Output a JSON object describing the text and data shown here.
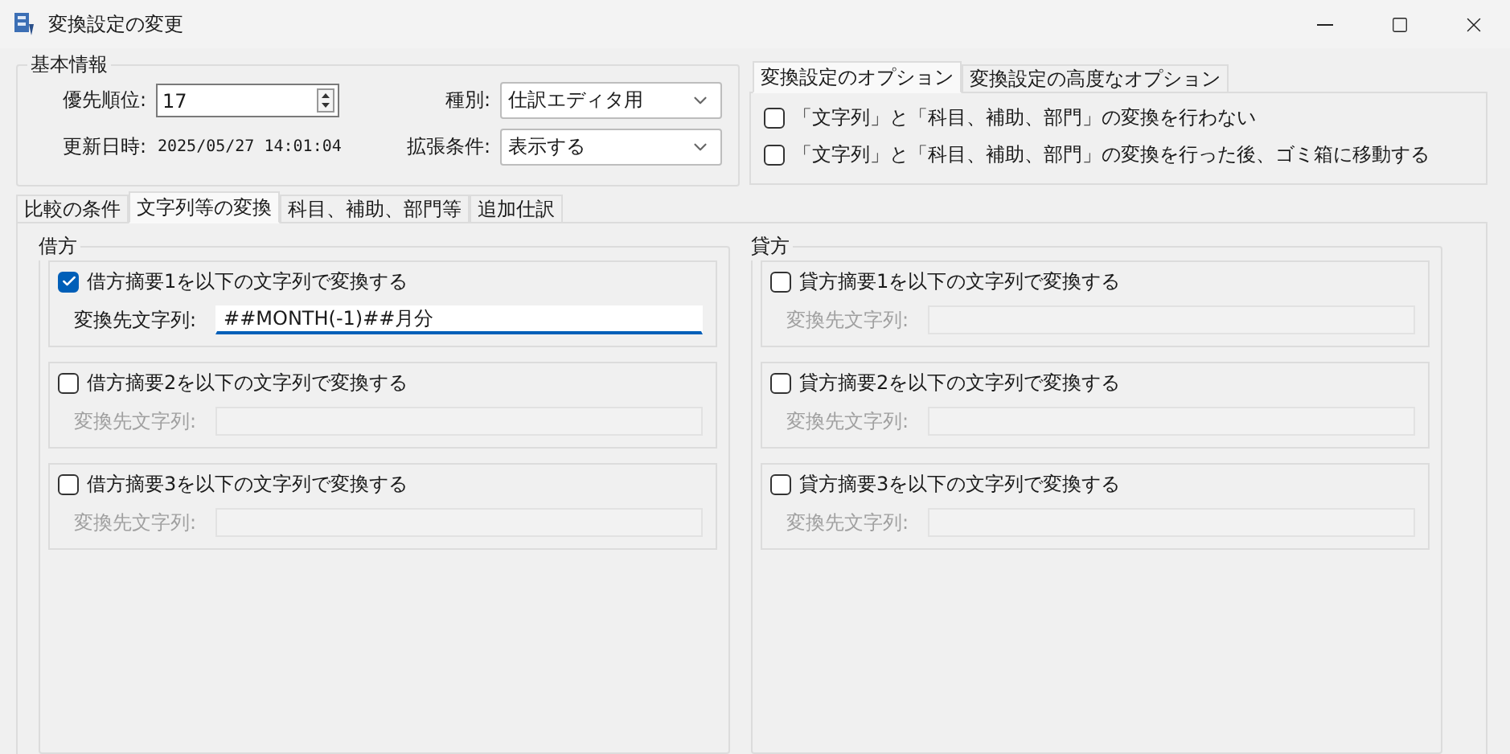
{
  "window": {
    "title": "変換設定の変更"
  },
  "basic_info": {
    "title": "基本情報",
    "priority": {
      "label": "優先順位:",
      "value": "17"
    },
    "type": {
      "label": "種別:",
      "value": "仕訳エディタ用"
    },
    "updated": {
      "label": "更新日時:",
      "value": "2025/05/27 14:01:04"
    },
    "extended_condition": {
      "label": "拡張条件:",
      "value": "表示する"
    }
  },
  "option_tabs": [
    {
      "label": "変換設定のオプション",
      "selected": true
    },
    {
      "label": "変換設定の高度なオプション",
      "selected": false
    }
  ],
  "options": [
    {
      "label": "「文字列」と「科目、補助、部門」の変換を行わない",
      "checked": false
    },
    {
      "label": "「文字列」と「科目、補助、部門」の変換を行った後、ゴミ箱に移動する",
      "checked": false
    }
  ],
  "tabs": [
    {
      "label": "比較の条件",
      "selected": false
    },
    {
      "label": "文字列等の変換",
      "selected": true
    },
    {
      "label": "科目、補助、部門等",
      "selected": false
    },
    {
      "label": "追加仕訳",
      "selected": false
    }
  ],
  "groups": [
    {
      "title": "借方",
      "items": [
        {
          "label": "借方摘要1を以下の文字列で変換する",
          "checked": true,
          "field_label": "変換先文字列:",
          "value": "##MONTH(-1)##月分",
          "focused": true
        },
        {
          "label": "借方摘要2を以下の文字列で変換する",
          "checked": false,
          "field_label": "変換先文字列:",
          "focused": false
        },
        {
          "label": "借方摘要3を以下の文字列で変換する",
          "checked": false,
          "field_label": "変換先文字列:",
          "focused": false
        }
      ]
    },
    {
      "title": "貸方",
      "items": [
        {
          "label": "貸方摘要1を以下の文字列で変換する",
          "checked": false,
          "field_label": "変換先文字列:",
          "focused": false
        },
        {
          "label": "貸方摘要2を以下の文字列で変換する",
          "checked": false,
          "field_label": "変換先文字列:",
          "focused": false
        },
        {
          "label": "貸方摘要3を以下の文字列で変換する",
          "checked": false,
          "field_label": "変換先文字列:",
          "focused": false
        }
      ]
    }
  ]
}
